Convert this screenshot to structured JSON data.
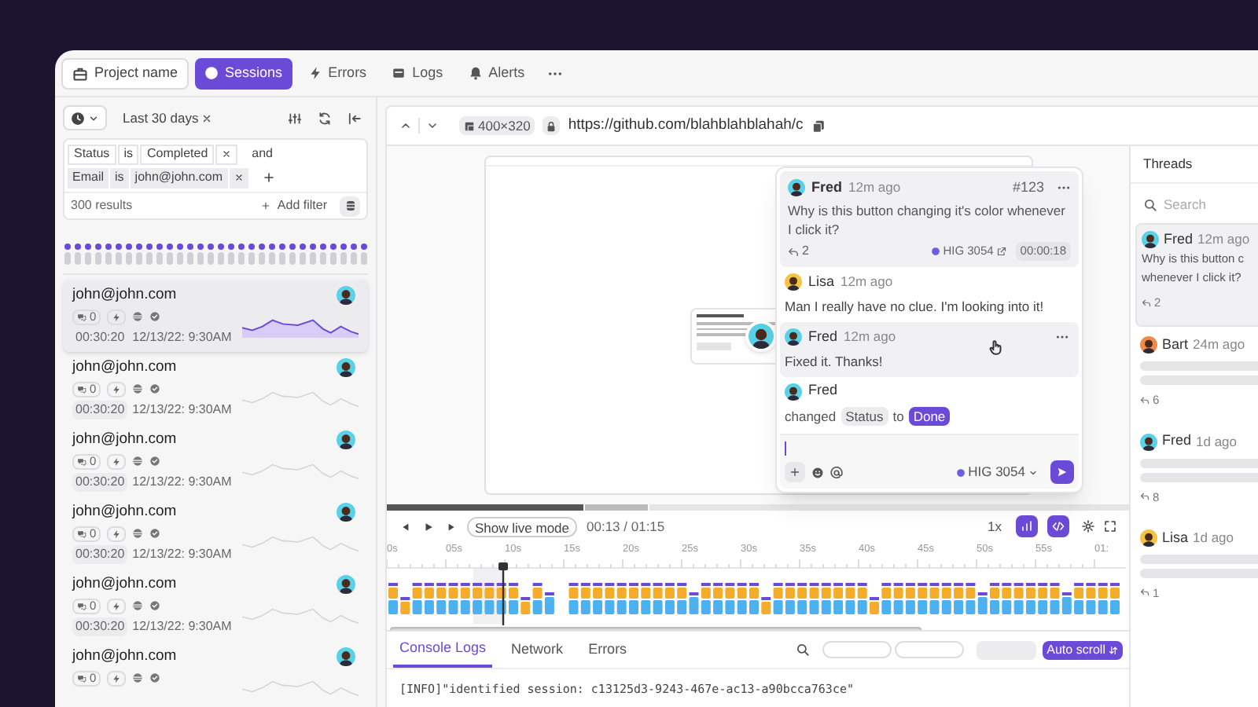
{
  "nav": {
    "project": "Project name",
    "tabs": [
      {
        "label": "Sessions",
        "selected": true
      },
      {
        "label": "Errors",
        "selected": false
      },
      {
        "label": "Logs",
        "selected": false
      },
      {
        "label": "Alerts",
        "selected": false
      }
    ]
  },
  "sessions_panel": {
    "date_range": "Last 30 days",
    "filters": [
      {
        "field": "Status",
        "op": "is",
        "value": "Completed",
        "join": "and"
      },
      {
        "field": "Email",
        "op": "is",
        "value": "john@john.com"
      }
    ],
    "results": "300 results",
    "add_filter": "Add filter",
    "sessions": [
      {
        "email": "john@john.com",
        "comments": "0",
        "duration": "00:30:20",
        "date": "12/13/22: 9:30AM",
        "selected": true
      },
      {
        "email": "john@john.com",
        "comments": "0",
        "duration": "00:30:20",
        "date": "12/13/22: 9:30AM",
        "selected": false
      },
      {
        "email": "john@john.com",
        "comments": "0",
        "duration": "00:30:20",
        "date": "12/13/22: 9:30AM",
        "selected": false
      },
      {
        "email": "john@john.com",
        "comments": "0",
        "duration": "00:30:20",
        "date": "12/13/22: 9:30AM",
        "selected": false
      },
      {
        "email": "john@john.com",
        "comments": "0",
        "duration": "00:30:20",
        "date": "12/13/22: 9:30AM",
        "selected": false
      },
      {
        "email": "john@john.com",
        "comments": "0",
        "selected": false
      }
    ]
  },
  "player": {
    "size": "400×320",
    "url": "https://github.com/blahblahblahah/c",
    "thread": {
      "author": "Fred",
      "color": "#5ad1e6",
      "time": "12m ago",
      "number": "#123",
      "text": "Why is this button changing it's color whenever I click it?",
      "replies": "2",
      "issue": "HIG 3054",
      "timestamp": "00:00:18",
      "comments": [
        {
          "kind": "message",
          "author": "Lisa",
          "color": "#f5c542",
          "time": "12m ago",
          "text": "Man I really have no clue. I'm looking into it!",
          "hovered": false
        },
        {
          "kind": "message",
          "author": "Fred",
          "color": "#5ad1e6",
          "time": "12m ago",
          "text": "Fixed it. Thanks!",
          "hovered": true
        },
        {
          "kind": "change",
          "author": "Fred",
          "color": "#5ad1e6",
          "verb": "changed",
          "field": "Status",
          "to": "to",
          "value": "Done"
        }
      ],
      "composer_issue": "HIG 3054"
    },
    "controls": {
      "live_mode": "Show live mode",
      "time": "00:13 / 01:15",
      "speed": "1x",
      "toggles": [
        {
          "on": true
        },
        {
          "on": true
        }
      ]
    },
    "ticks": [
      "0s",
      "05s",
      "10s",
      "15s",
      "20s",
      "25s",
      "30s",
      "35s",
      "40s",
      "45s",
      "50s",
      "55s",
      "01:"
    ],
    "tabs": [
      {
        "label": "Console Logs",
        "selected": true
      },
      {
        "label": "Network",
        "selected": false
      },
      {
        "label": "Errors",
        "selected": false
      }
    ],
    "auto_scroll": "Auto scroll",
    "log": "[INFO]\"identified session: c13125d3-9243-467e-ac13-a90bcca763ce\""
  },
  "threads": {
    "title": "Threads",
    "search_placeholder": "Search",
    "items": [
      {
        "author": "Fred",
        "color": "#5ad1e6",
        "time": "12m ago",
        "lines": [
          "Why is this button c",
          "whenever I click it?"
        ],
        "replies": "2",
        "selected": true
      },
      {
        "author": "Bart",
        "color": "#f08a4b",
        "time": "24m ago",
        "replies": "6",
        "selected": false
      },
      {
        "author": "Fred",
        "color": "#5ad1e6",
        "time": "1d ago",
        "replies": "8",
        "selected": false
      },
      {
        "author": "Lisa",
        "color": "#f5c542",
        "time": "1d ago",
        "replies": "1",
        "selected": false
      }
    ]
  }
}
